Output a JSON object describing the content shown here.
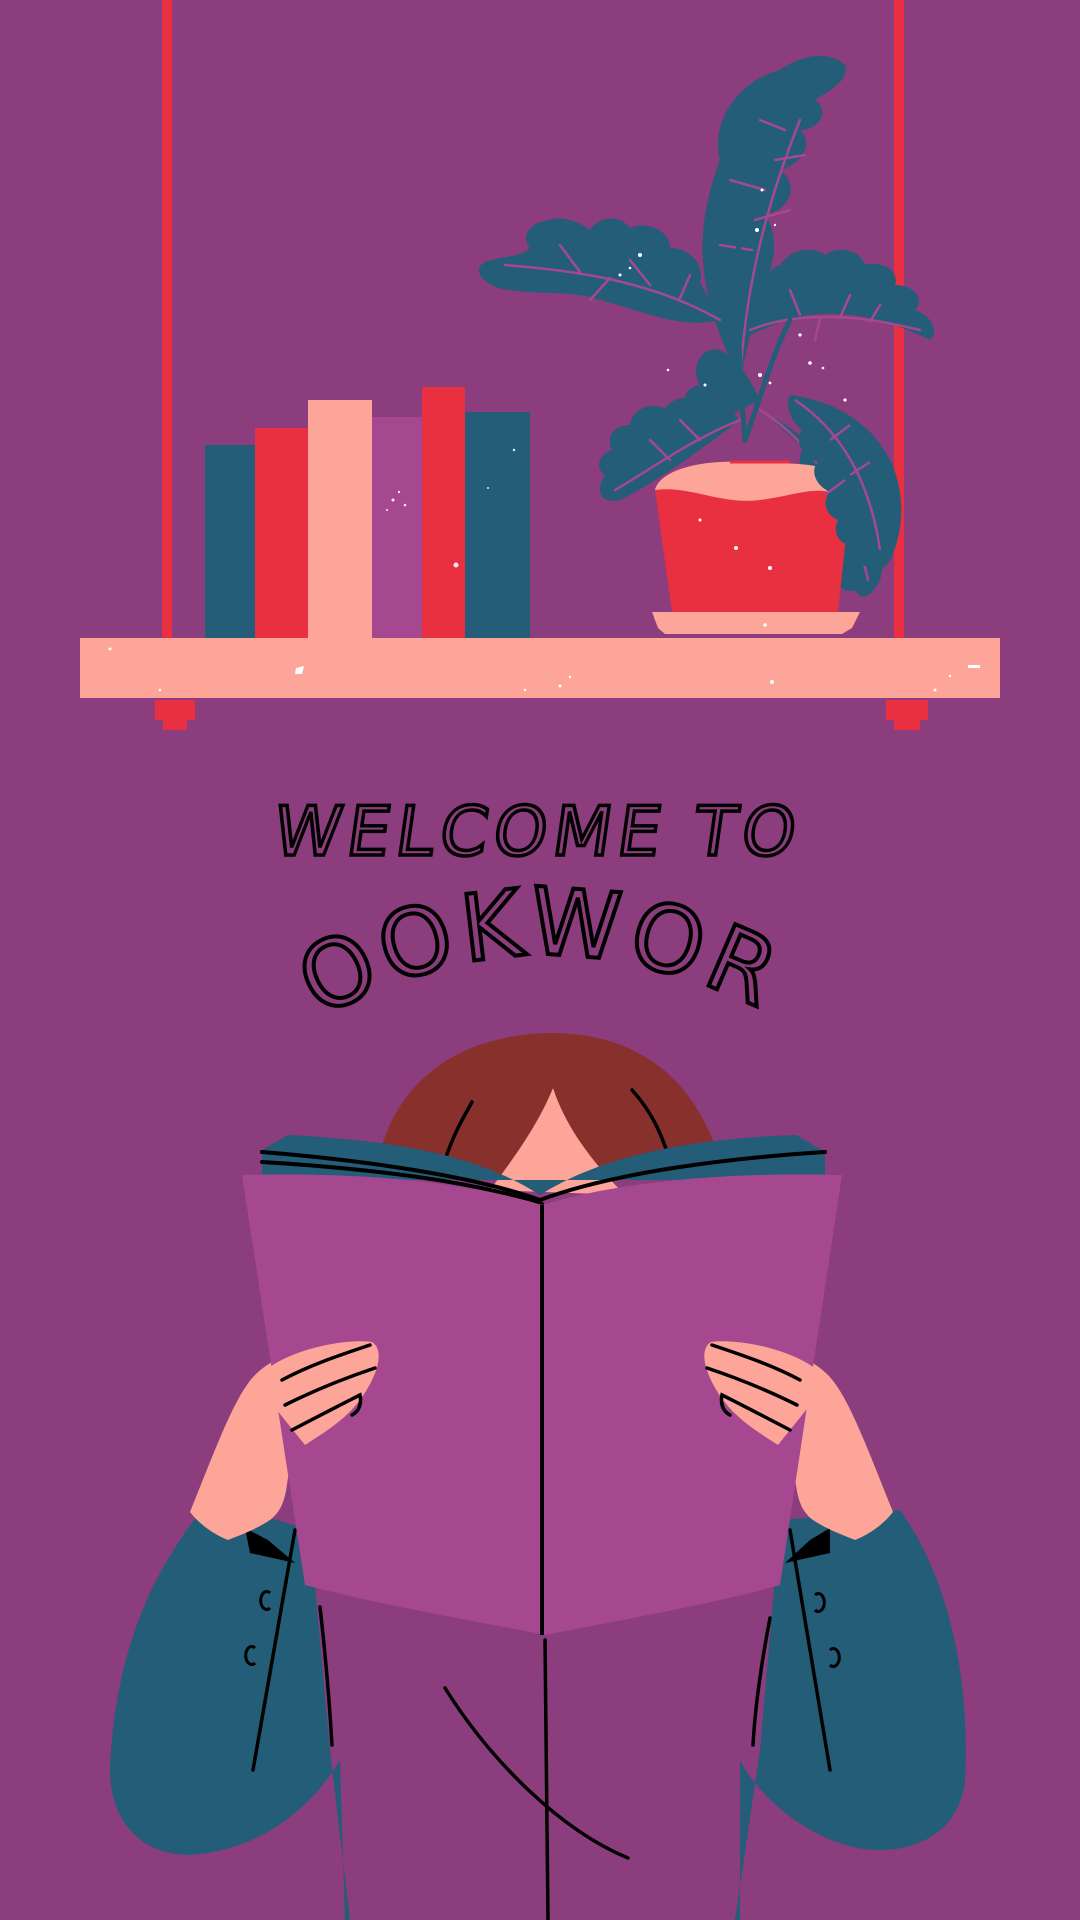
{
  "poster": {
    "line1": "WELCOME TO",
    "line2": "BOOKWORM"
  },
  "colors": {
    "background": "#8b3d7d",
    "teal": "#235d78",
    "red": "#e83040",
    "peach": "#fca598",
    "purple": "#a5488f",
    "hair": "#87302c",
    "ink": "#000000"
  },
  "icons": [
    "bookshelf-illustration",
    "potted-plant-illustration",
    "reader-with-book-illustration"
  ]
}
